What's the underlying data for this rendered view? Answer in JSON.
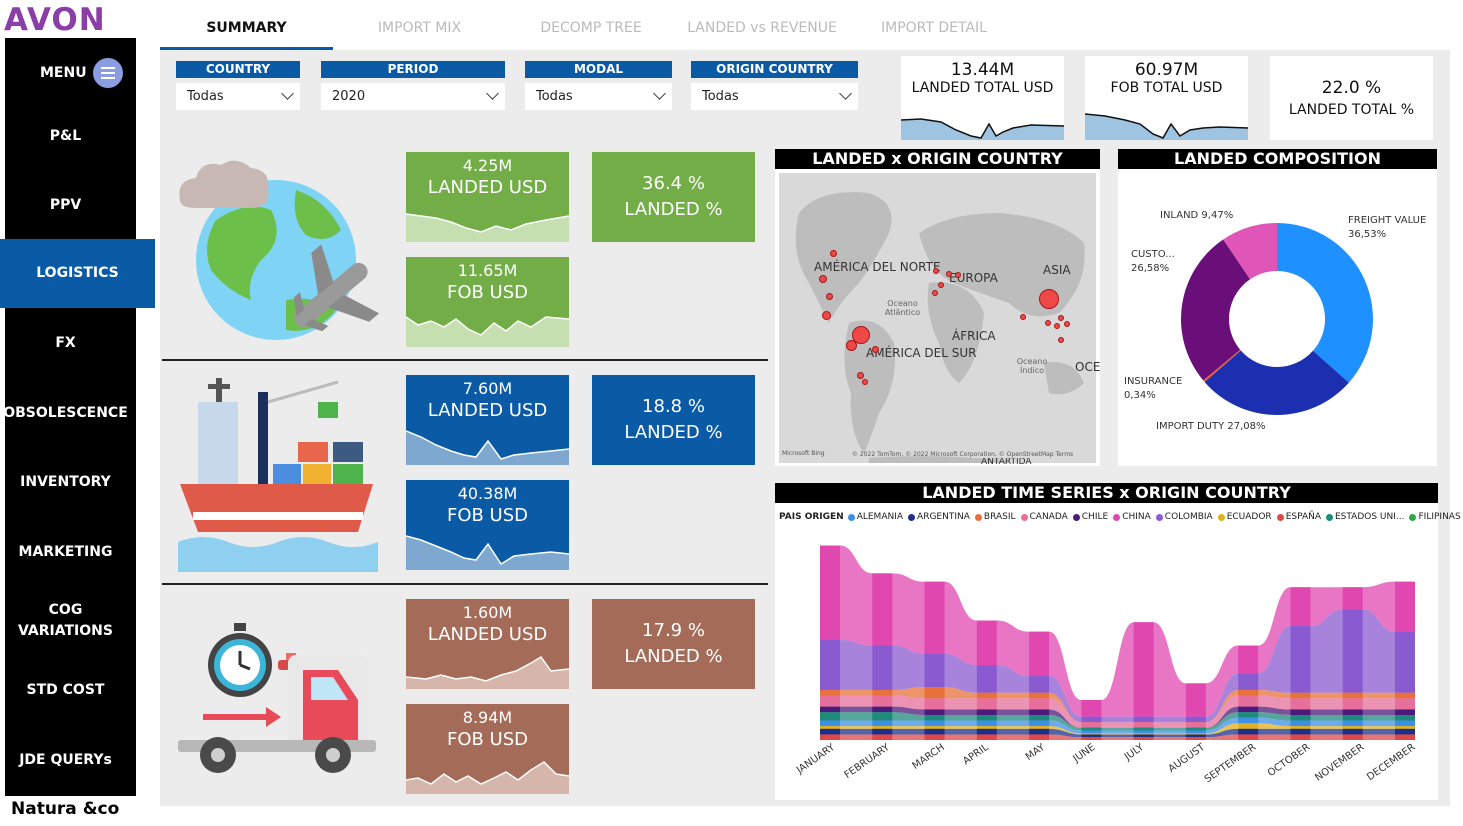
{
  "brand": {
    "logo": "AVON",
    "footer_logo": "Natura &co"
  },
  "sidebar": {
    "menu_label": "MENU",
    "items": [
      {
        "label": "P&L",
        "active": false
      },
      {
        "label": "PPV",
        "active": false
      },
      {
        "label": "LOGISTICS",
        "active": true
      },
      {
        "label": "FX",
        "active": false
      },
      {
        "label": "OBSOLESCENCE",
        "active": false
      },
      {
        "label": "INVENTORY",
        "active": false
      },
      {
        "label": "MARKETING",
        "active": false
      },
      {
        "label": "COG\nVARIATIONS",
        "active": false
      },
      {
        "label": "STD COST",
        "active": false
      },
      {
        "label": "JDE QUERYs",
        "active": false
      }
    ]
  },
  "tabs": [
    {
      "label": "SUMMARY",
      "active": true
    },
    {
      "label": "IMPORT MIX",
      "active": false
    },
    {
      "label": "DECOMP TREE",
      "active": false
    },
    {
      "label": "LANDED vs REVENUE",
      "active": false
    },
    {
      "label": "IMPORT DETAIL",
      "active": false
    }
  ],
  "filters": [
    {
      "label": "COUNTRY",
      "value": "Todas"
    },
    {
      "label": "PERIOD",
      "value": "2020"
    },
    {
      "label": "MODAL",
      "value": "Todas"
    },
    {
      "label": "ORIGIN COUNTRY",
      "value": "Todas"
    }
  ],
  "kpis": [
    {
      "value": "13.44M",
      "label": "LANDED TOTAL USD"
    },
    {
      "value": "60.97M",
      "label": "FOB TOTAL USD"
    },
    {
      "value": "22.0 %",
      "label": "LANDED TOTAL %"
    }
  ],
  "modes": [
    {
      "name": "air",
      "color": "#72ad47",
      "landed_value": "4.25M",
      "landed_label": "LANDED USD",
      "fob_value": "11.65M",
      "fob_label": "FOB USD",
      "pct_value": "36.4 %",
      "pct_label": "LANDED %"
    },
    {
      "name": "sea",
      "color": "#0b5aa6",
      "landed_value": "7.60M",
      "landed_label": "LANDED USD",
      "fob_value": "40.38M",
      "fob_label": "FOB USD",
      "pct_value": "18.8 %",
      "pct_label": "LANDED %"
    },
    {
      "name": "road",
      "color": "#a36b58",
      "landed_value": "1.60M",
      "landed_label": "LANDED USD",
      "fob_value": "8.94M",
      "fob_label": "FOB USD",
      "pct_value": "17.9 %",
      "pct_label": "LANDED %"
    }
  ],
  "map": {
    "title": "LANDED x ORIGIN COUNTRY",
    "regions": [
      "AMÉRICA DEL NORTE",
      "EUROPA",
      "ASIA",
      "ÁFRICA",
      "AMÉRICA DEL SUR",
      "OCE",
      "ANTARTIDA"
    ],
    "oceans": [
      "Oceano Atlântico",
      "Oceano Índico"
    ],
    "attribution": "© 2022 TomTom, © 2022 Microsoft Corporation, © OpenStreetMap  Terms",
    "bing": "Microsoft Bing"
  },
  "composition": {
    "title": "LANDED COMPOSITION",
    "chart_data": {
      "type": "pie",
      "categories": [
        "FREIGHT VALUE",
        "IMPORT DUTY",
        "INSURANCE",
        "CUSTO...",
        "INLAND"
      ],
      "values": [
        36.53,
        27.08,
        0.34,
        26.58,
        9.47
      ],
      "labels": [
        "FREIGHT VALUE 36,53%",
        "IMPORT DUTY 27,08%",
        "INSURANCE 0,34%",
        "CUSTO... 26,58%",
        "INLAND 9,47%"
      ],
      "colors": [
        "#1e90ff",
        "#1c2fb0",
        "#e85a3a",
        "#6a0f7a",
        "#e056b8"
      ]
    }
  },
  "timeseries": {
    "title": "LANDED TIME SERIES x ORIGIN COUNTRY",
    "legend_title": "PAIS ORIGEN",
    "legend": [
      {
        "name": "ALEMANIA",
        "color": "#3d8fe6"
      },
      {
        "name": "ARGENTINA",
        "color": "#1c2f8a"
      },
      {
        "name": "BRASIL",
        "color": "#e8703a"
      },
      {
        "name": "CANADA",
        "color": "#e66f9c"
      },
      {
        "name": "CHILE",
        "color": "#4b1a7a"
      },
      {
        "name": "CHINA",
        "color": "#e048b0"
      },
      {
        "name": "COLOMBIA",
        "color": "#8a5ad0"
      },
      {
        "name": "ECUADOR",
        "color": "#e0b020"
      },
      {
        "name": "ESPAÑA",
        "color": "#e04848"
      },
      {
        "name": "ESTADOS UNI...",
        "color": "#1e8a7a"
      },
      {
        "name": "FILIPINAS",
        "color": "#2aa84a"
      }
    ],
    "chart_data": {
      "type": "area",
      "categories": [
        "JANUARY",
        "FEBRUARY",
        "MARCH",
        "APRIL",
        "MAY",
        "JUNE",
        "JULY",
        "AUGUST",
        "SEPTEMBER",
        "OCTOBER",
        "NOVEMBER",
        "DECEMBER"
      ],
      "series": [
        {
          "name": "CHINA",
          "values": [
            1.7,
            1.3,
            1.3,
            0.8,
            0.8,
            0.3,
            1.7,
            0.6,
            0.5,
            0.7,
            0.4,
            0.9
          ]
        },
        {
          "name": "COLOMBIA",
          "values": [
            0.9,
            0.8,
            0.6,
            0.5,
            0.3,
            0.1,
            0.1,
            0.1,
            0.3,
            1.2,
            1.5,
            1.1
          ]
        },
        {
          "name": "BRASIL",
          "values": [
            0.1,
            0.1,
            0.2,
            0.1,
            0.1,
            0.0,
            0.0,
            0.0,
            0.1,
            0.1,
            0.1,
            0.1
          ]
        },
        {
          "name": "CANADA",
          "values": [
            0.2,
            0.2,
            0.2,
            0.2,
            0.2,
            0.1,
            0.1,
            0.1,
            0.2,
            0.2,
            0.2,
            0.2
          ]
        },
        {
          "name": "CHILE",
          "values": [
            0.1,
            0.1,
            0.1,
            0.1,
            0.1,
            0.0,
            0.0,
            0.0,
            0.1,
            0.1,
            0.1,
            0.1
          ]
        },
        {
          "name": "ESTADOS UNI...",
          "values": [
            0.15,
            0.15,
            0.1,
            0.1,
            0.1,
            0.05,
            0.05,
            0.05,
            0.1,
            0.1,
            0.1,
            0.1
          ]
        },
        {
          "name": "ALEMANIA",
          "values": [
            0.1,
            0.1,
            0.1,
            0.1,
            0.1,
            0.05,
            0.05,
            0.05,
            0.1,
            0.1,
            0.1,
            0.1
          ]
        },
        {
          "name": "ECUADOR",
          "values": [
            0.05,
            0.05,
            0.05,
            0.05,
            0.05,
            0.02,
            0.02,
            0.02,
            0.1,
            0.05,
            0.05,
            0.05
          ]
        },
        {
          "name": "ARGENTINA",
          "values": [
            0.1,
            0.1,
            0.1,
            0.1,
            0.1,
            0.05,
            0.05,
            0.05,
            0.1,
            0.1,
            0.1,
            0.1
          ]
        },
        {
          "name": "ESPAÑA",
          "values": [
            0.1,
            0.1,
            0.1,
            0.1,
            0.1,
            0.05,
            0.05,
            0.05,
            0.1,
            0.1,
            0.1,
            0.1
          ]
        }
      ]
    }
  }
}
